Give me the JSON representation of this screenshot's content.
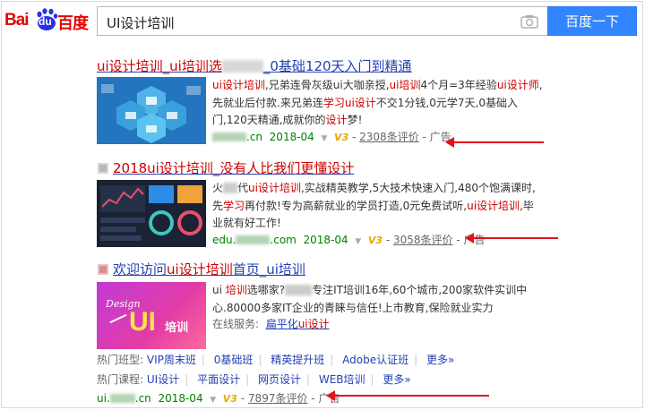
{
  "header": {
    "logo_bai": "Bai",
    "logo_du": "du",
    "logo_cn": "百度",
    "query": "UI设计培训",
    "search_button": "百度一下"
  },
  "results": [
    {
      "title_a": "ui设计培训_ui培训选",
      "title_b": "_0基础120天入门到精通",
      "desc_parts": [
        "ui设计培训",
        ",兄弟连骨灰级ui大咖亲授,",
        "ui培训",
        "4个月=3年经验",
        "ui设计师",
        ",先就业后付款.来兄弟连",
        "学习",
        "ui设计",
        "不交1分钱,0元学7天,0基础入门,120天精通,成就你的",
        "设计",
        "梦!"
      ],
      "url_suffix": ".cn",
      "date": "2018-04",
      "v": "V3",
      "eval": "2308条评价",
      "ad": "广告"
    },
    {
      "title": "2018ui设计培训_没有人比我们更懂设计",
      "desc_parts": [
        "火",
        "代",
        "ui设计培训",
        ",实战精英教学,5大技术快速入门,480个饱满课时,先",
        "学习",
        "再付款!专为高薪就业的学员打造,0元免费试听,",
        "ui设计培训",
        ",毕业就有好工作!"
      ],
      "url_prefix": "edu.",
      "url_suffix": ".com",
      "date": "2018-04",
      "v": "V3",
      "eval": "3058条评价",
      "ad": "广告"
    },
    {
      "title_a": "欢迎访问",
      "title_b": "ui设计培训",
      "title_c": "首页_ui培训",
      "desc_parts": [
        "ui ",
        "培训",
        "选哪家?",
        "专注IT培训16年,60个城市,200家软件实训中心.80000多家IT企业的青睐与信任!上市教育,保险就业实力"
      ],
      "online_label": "在线服务:",
      "online_link_a": "扁平化",
      "online_link_b": "ui设计",
      "thumb_text_design": "Design",
      "thumb_text_ui": "UI",
      "thumb_text_cn": "培训",
      "class_label": "热门班型:",
      "class_links": [
        "VIP周末班",
        "0基础班",
        "精英提升班",
        "Adobe认证班",
        "更多»"
      ],
      "course_label": "热门课程:",
      "course_links": [
        "UI设计",
        "平面设计",
        "网页设计",
        "WEB培训",
        "更多»"
      ],
      "url_prefix": "ui.",
      "url_suffix": ".cn",
      "date": "2018-04",
      "v": "V3",
      "eval": "7897条评价",
      "ad": "广告"
    }
  ],
  "colors": {
    "brand_red": "#e10602",
    "link_blue": "#2440b3",
    "search_blue": "#3385ff",
    "url_green": "#008000",
    "arrow_red": "#e0131f"
  }
}
